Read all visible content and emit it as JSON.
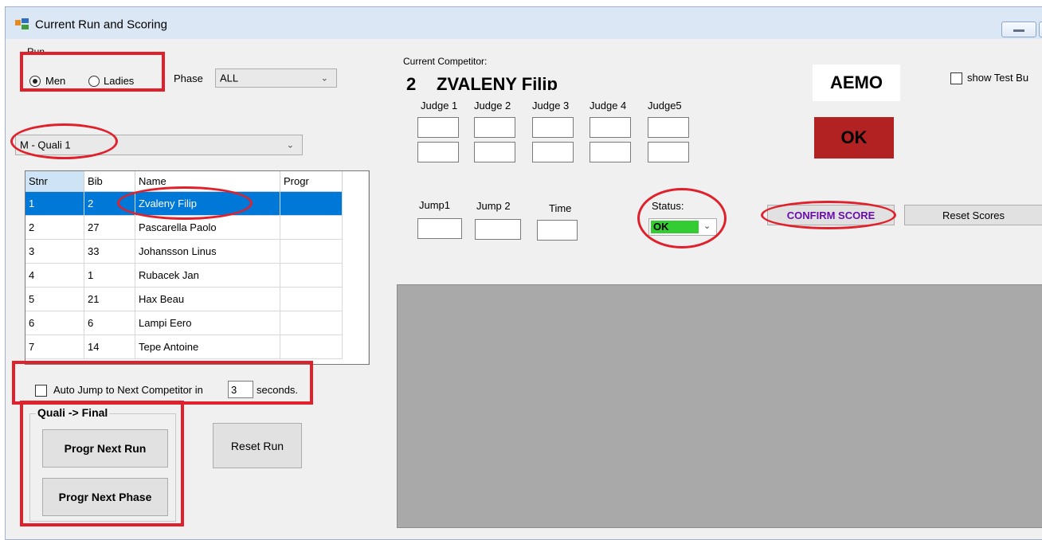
{
  "window": {
    "title": "Current Run and Scoring"
  },
  "run": {
    "group_label": "Run",
    "options": [
      "Men",
      "Ladies"
    ],
    "selected": "Men"
  },
  "phase": {
    "label": "Phase",
    "value": "ALL"
  },
  "run_select": {
    "value": "M - Quali 1"
  },
  "grid": {
    "columns": [
      "Stnr",
      "Bib",
      "Name",
      "Progr"
    ],
    "rows": [
      [
        "1",
        "2",
        "Zvaleny Filip",
        ""
      ],
      [
        "2",
        "27",
        "Pascarella Paolo",
        ""
      ],
      [
        "3",
        "33",
        "Johansson Linus",
        ""
      ],
      [
        "4",
        "1",
        "Rubacek Jan",
        ""
      ],
      [
        "5",
        "21",
        "Hax Beau",
        ""
      ],
      [
        "6",
        "6",
        "Lampi Eero",
        ""
      ],
      [
        "7",
        "14",
        "Tepe Antoine",
        ""
      ]
    ]
  },
  "auto_jump": {
    "label": "Auto Jump to Next Competitor in",
    "seconds_value": "3",
    "suffix": "seconds.",
    "checked": false
  },
  "progression": {
    "group_label": "Quali -> Final",
    "next_run": "Progr Next Run",
    "next_phase": "Progr Next Phase"
  },
  "reset_run": "Reset Run",
  "competitor": {
    "label": "Current Competitor:",
    "bib": "2",
    "name": "ZVALENY Filip"
  },
  "judges": [
    "Judge 1",
    "Judge 2",
    "Judge 3",
    "Judge 4",
    "Judge5"
  ],
  "scores": {
    "jump1": "Jump1",
    "jump2": "Jump 2",
    "time": "Time"
  },
  "status": {
    "label": "Status:",
    "value": "OK",
    "color": "#33cc33"
  },
  "buttons": {
    "confirm": "CONFIRM SCORE",
    "reset_scores": "Reset Scores"
  },
  "aemo": {
    "label": "AEMO",
    "ok_label": "OK",
    "ok_color": "#b22222"
  },
  "show_test": {
    "label": "show Test Bu",
    "checked": false
  }
}
